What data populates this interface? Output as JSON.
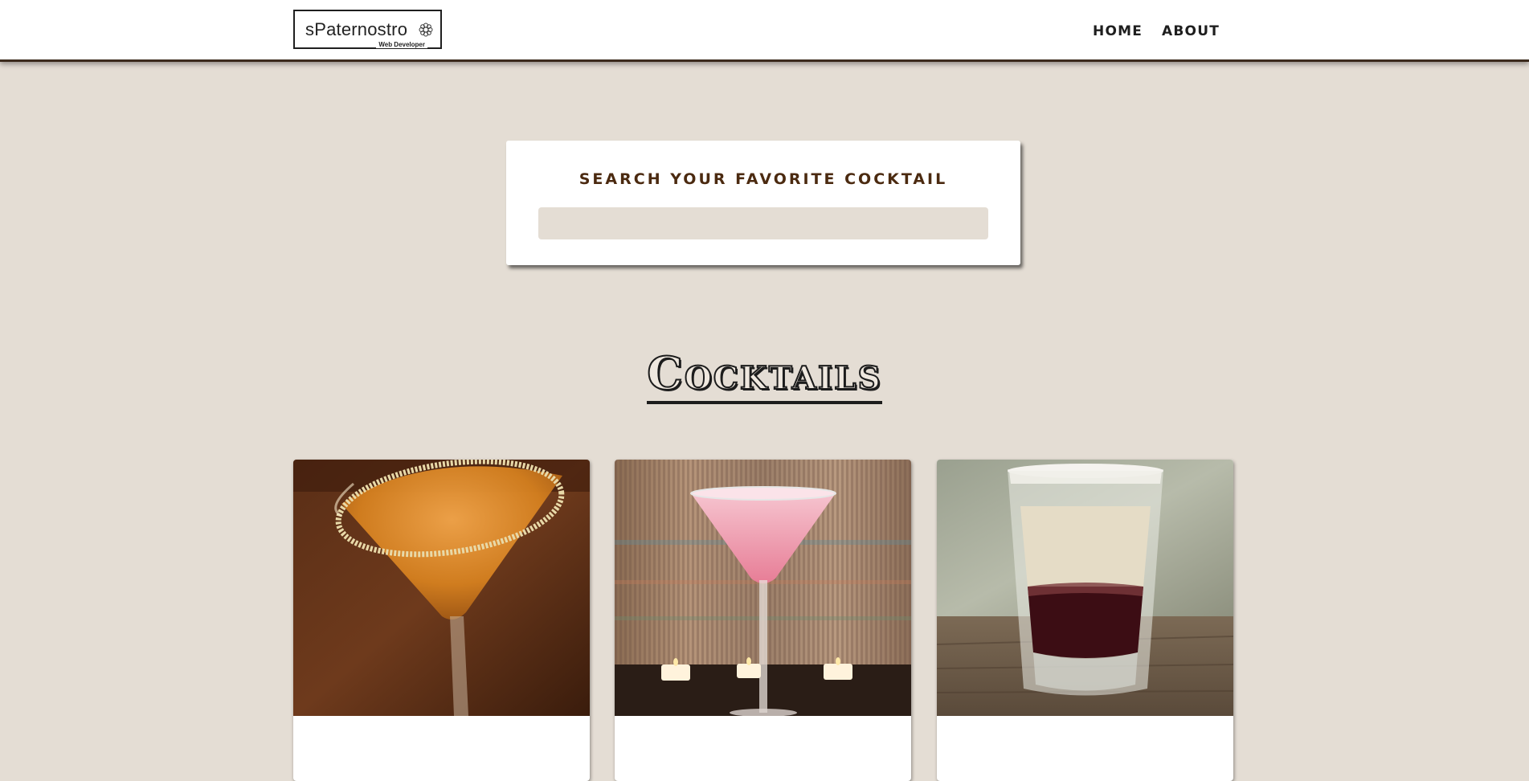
{
  "header": {
    "logo_name": "sPaterno stro",
    "logo_name_display": "sPaternostro",
    "logo_tagline": "Web Developer",
    "nav": [
      {
        "label": "HOME"
      },
      {
        "label": "ABOUT"
      }
    ]
  },
  "search": {
    "title": "SEARCH YOUR FAVORITE COCKTAIL",
    "value": ""
  },
  "main": {
    "section_title": "Cocktails",
    "cards": [
      {
        "image_icon": "orange-martini-photo"
      },
      {
        "image_icon": "pink-martini-photo"
      },
      {
        "image_icon": "layered-shot-photo"
      }
    ]
  },
  "colors": {
    "background": "#e4ddd4",
    "header_border": "#3b2a1c",
    "search_title": "#4b2a10"
  }
}
